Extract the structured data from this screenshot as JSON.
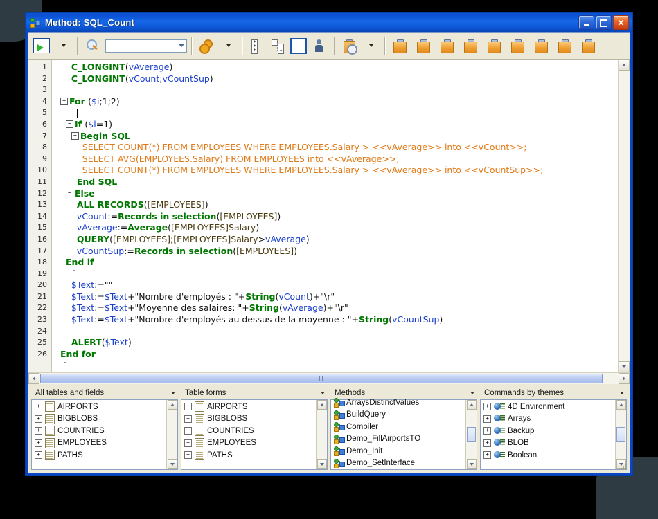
{
  "window": {
    "title": "Method: SQL_Count",
    "icon": "method-node-icon",
    "buttons": {
      "minimize": "_",
      "maximize": "□",
      "close": "✕"
    }
  },
  "toolbar": {
    "run_label": "run-method",
    "run_dropdown": "run-options",
    "search_icon": "search-icon",
    "search_value": "",
    "search_placeholder": "",
    "macros_label": "macros",
    "macros_dropdown": "macros-options",
    "expand_all": "expand-all",
    "collapse_all": "collapse-all",
    "list_label": "method-list",
    "info_label": "method-properties",
    "history_label": "history",
    "history_dropdown": "history-options",
    "clipboard_count": 9
  },
  "editor": {
    "lines": [
      {
        "n": 1,
        "indent": 2,
        "fold": null,
        "tokens": [
          {
            "t": "cmd",
            "s": "C_LONGINT"
          },
          {
            "t": "plain",
            "s": "("
          },
          {
            "t": "var",
            "s": "vAverage"
          },
          {
            "t": "plain",
            "s": ")"
          }
        ]
      },
      {
        "n": 2,
        "indent": 2,
        "fold": null,
        "tokens": [
          {
            "t": "cmd",
            "s": "C_LONGINT"
          },
          {
            "t": "plain",
            "s": "("
          },
          {
            "t": "var",
            "s": "vCount"
          },
          {
            "t": "plain",
            "s": ";"
          },
          {
            "t": "var",
            "s": "vCountSup"
          },
          {
            "t": "plain",
            "s": ")"
          }
        ]
      },
      {
        "n": 3,
        "indent": 0,
        "fold": null,
        "tokens": []
      },
      {
        "n": 4,
        "indent": 0,
        "fold": "minus",
        "tokens": [
          {
            "t": "kw",
            "s": "For "
          },
          {
            "t": "plain",
            "s": "("
          },
          {
            "t": "var",
            "s": "$i"
          },
          {
            "t": "plain",
            "s": ";1;2)"
          }
        ]
      },
      {
        "n": 5,
        "indent": 3,
        "fold": null,
        "caret": true,
        "tokens": []
      },
      {
        "n": 6,
        "indent": 1,
        "fold": "minus",
        "tokens": [
          {
            "t": "kw",
            "s": "If "
          },
          {
            "t": "plain",
            "s": "("
          },
          {
            "t": "var",
            "s": "$i"
          },
          {
            "t": "plain",
            "s": "=1)"
          }
        ]
      },
      {
        "n": 7,
        "indent": 2,
        "fold": "minus",
        "tokens": [
          {
            "t": "kw",
            "s": "Begin SQL"
          }
        ]
      },
      {
        "n": 8,
        "indent": 4,
        "fold": null,
        "tokens": [
          {
            "t": "sql",
            "s": "SELECT COUNT(*) FROM EMPLOYEES WHERE EMPLOYEES.Salary > <<vAverage>> into <<vCount>>;"
          }
        ]
      },
      {
        "n": 9,
        "indent": 4,
        "fold": null,
        "tokens": [
          {
            "t": "sql",
            "s": "SELECT AVG(EMPLOYEES.Salary) FROM EMPLOYEES into <<vAverage>>;"
          }
        ]
      },
      {
        "n": 10,
        "indent": 4,
        "fold": null,
        "tokens": [
          {
            "t": "sql",
            "s": "SELECT COUNT(*) FROM EMPLOYEES WHERE EMPLOYEES.Salary > <<vAverage>> into <<vCountSup>>;"
          }
        ]
      },
      {
        "n": 11,
        "indent": 3,
        "fold": null,
        "tokens": [
          {
            "t": "kw",
            "s": "End SQL"
          }
        ]
      },
      {
        "n": 12,
        "indent": 1,
        "fold": "minus",
        "tokens": [
          {
            "t": "kw",
            "s": "Else"
          }
        ]
      },
      {
        "n": 13,
        "indent": 3,
        "fold": null,
        "tokens": [
          {
            "t": "cmd",
            "s": "ALL RECORDS"
          },
          {
            "t": "plain",
            "s": "("
          },
          {
            "t": "tbl",
            "s": "[EMPLOYEES]"
          },
          {
            "t": "plain",
            "s": ")"
          }
        ]
      },
      {
        "n": 14,
        "indent": 3,
        "fold": null,
        "tokens": [
          {
            "t": "var",
            "s": "vCount"
          },
          {
            "t": "plain",
            "s": ":="
          },
          {
            "t": "cmd",
            "s": "Records in selection"
          },
          {
            "t": "plain",
            "s": "("
          },
          {
            "t": "tbl",
            "s": "[EMPLOYEES]"
          },
          {
            "t": "plain",
            "s": ")"
          }
        ]
      },
      {
        "n": 15,
        "indent": 3,
        "fold": null,
        "tokens": [
          {
            "t": "var",
            "s": "vAverage"
          },
          {
            "t": "plain",
            "s": ":="
          },
          {
            "t": "cmd",
            "s": "Average"
          },
          {
            "t": "plain",
            "s": "("
          },
          {
            "t": "tbl",
            "s": "[EMPLOYEES]Salary"
          },
          {
            "t": "plain",
            "s": ")"
          }
        ]
      },
      {
        "n": 16,
        "indent": 3,
        "fold": null,
        "tokens": [
          {
            "t": "cmd",
            "s": "QUERY"
          },
          {
            "t": "plain",
            "s": "("
          },
          {
            "t": "tbl",
            "s": "[EMPLOYEES]"
          },
          {
            "t": "plain",
            "s": ";"
          },
          {
            "t": "tbl",
            "s": "[EMPLOYEES]Salary"
          },
          {
            "t": "plain",
            "s": ">"
          },
          {
            "t": "var",
            "s": "vAverage"
          },
          {
            "t": "plain",
            "s": ")"
          }
        ]
      },
      {
        "n": 17,
        "indent": 3,
        "fold": null,
        "tokens": [
          {
            "t": "var",
            "s": "vCountSup"
          },
          {
            "t": "plain",
            "s": ":="
          },
          {
            "t": "cmd",
            "s": "Records in selection"
          },
          {
            "t": "plain",
            "s": "("
          },
          {
            "t": "tbl",
            "s": "[EMPLOYEES]"
          },
          {
            "t": "plain",
            "s": ")"
          }
        ]
      },
      {
        "n": 18,
        "indent": 1,
        "fold": null,
        "tokens": [
          {
            "t": "kw",
            "s": "End if"
          }
        ]
      },
      {
        "n": 19,
        "indent": 0,
        "fold": null,
        "tokens": []
      },
      {
        "n": 20,
        "indent": 2,
        "fold": null,
        "tokens": [
          {
            "t": "var",
            "s": "$Text"
          },
          {
            "t": "plain",
            "s": ":=\"\""
          }
        ]
      },
      {
        "n": 21,
        "indent": 2,
        "fold": null,
        "tokens": [
          {
            "t": "var",
            "s": "$Text"
          },
          {
            "t": "plain",
            "s": ":="
          },
          {
            "t": "var",
            "s": "$Text"
          },
          {
            "t": "plain",
            "s": "+\"Nombre d'employés : \"+"
          },
          {
            "t": "cmd",
            "s": "String"
          },
          {
            "t": "plain",
            "s": "("
          },
          {
            "t": "var",
            "s": "vCount"
          },
          {
            "t": "plain",
            "s": ")+\"\\r\""
          }
        ]
      },
      {
        "n": 22,
        "indent": 2,
        "fold": null,
        "tokens": [
          {
            "t": "var",
            "s": "$Text"
          },
          {
            "t": "plain",
            "s": ":="
          },
          {
            "t": "var",
            "s": "$Text"
          },
          {
            "t": "plain",
            "s": "+\"Moyenne des salaires: \"+"
          },
          {
            "t": "cmd",
            "s": "String"
          },
          {
            "t": "plain",
            "s": "("
          },
          {
            "t": "var",
            "s": "vAverage"
          },
          {
            "t": "plain",
            "s": ")+\"\\r\""
          }
        ]
      },
      {
        "n": 23,
        "indent": 2,
        "fold": null,
        "tokens": [
          {
            "t": "var",
            "s": "$Text"
          },
          {
            "t": "plain",
            "s": ":="
          },
          {
            "t": "var",
            "s": "$Text"
          },
          {
            "t": "plain",
            "s": "+\"Nombre d'employés au dessus de la moyenne : \"+"
          },
          {
            "t": "cmd",
            "s": "String"
          },
          {
            "t": "plain",
            "s": "("
          },
          {
            "t": "var",
            "s": "vCountSup"
          },
          {
            "t": "plain",
            "s": ")"
          }
        ]
      },
      {
        "n": 24,
        "indent": 0,
        "fold": null,
        "tokens": []
      },
      {
        "n": 25,
        "indent": 2,
        "fold": null,
        "tokens": [
          {
            "t": "cmd",
            "s": "ALERT"
          },
          {
            "t": "plain",
            "s": "("
          },
          {
            "t": "var",
            "s": "$Text"
          },
          {
            "t": "plain",
            "s": ")"
          }
        ]
      },
      {
        "n": 26,
        "indent": 0,
        "fold": null,
        "tokens": [
          {
            "t": "kw",
            "s": "End for"
          }
        ]
      }
    ]
  },
  "panels": [
    {
      "title": "All tables and fields",
      "icon": "table-icon",
      "items": [
        "AIRPORTS",
        "BIGBLOBS",
        "COUNTRIES",
        "EMPLOYEES",
        "PATHS"
      ]
    },
    {
      "title": "Table forms",
      "icon": "table-icon",
      "items": [
        "AIRPORTS",
        "BIGBLOBS",
        "COUNTRIES",
        "EMPLOYEES",
        "PATHS"
      ]
    },
    {
      "title": "Methods",
      "icon": "method-icon",
      "items": [
        "ArraysDistinctValues",
        "BuildQuery",
        "Compiler",
        "Demo_FillAirportsTO",
        "Demo_Init",
        "Demo_SetInterface"
      ]
    },
    {
      "title": "Commands by themes",
      "icon": "theme-icon",
      "items": [
        "4D Environment",
        "Arrays",
        "Backup",
        "BLOB",
        "Boolean"
      ]
    }
  ],
  "colors": {
    "keyword": "#007700",
    "variable": "#1a3fcc",
    "sql": "#e07a18",
    "table": "#4a3b10",
    "titlebar": "#0a4fd0",
    "chrome": "#ece9d8"
  },
  "expand_glyph": "+",
  "collapse_glyph": "−"
}
